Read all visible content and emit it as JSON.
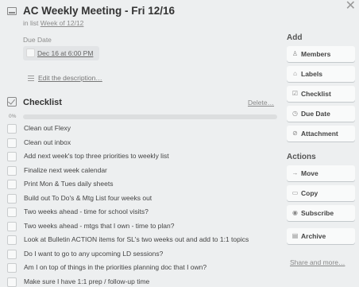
{
  "card": {
    "title": "AC Weekly Meeting - Fri 12/16",
    "in_list_prefix": "in list",
    "list_name": "Week of 12/12",
    "close_glyph": "✕",
    "due_date_label": "Due Date",
    "due_date_value": "Dec 16 at 6:00 PM",
    "description_link": "Edit the description…"
  },
  "checklist": {
    "title": "Checklist",
    "delete_label": "Delete…",
    "progress_label": "0%",
    "progress_value": 0,
    "progress_color": "#5aac44",
    "items": [
      "Clean out Flexy",
      "Clean out inbox",
      "Add next week's top three priorities to weekly list",
      "Finalize next week calendar",
      "Print Mon & Tues daily sheets",
      "Build out To Do's & Mtg List four weeks out",
      "Two weeks ahead - time for school visits?",
      "Two weeks ahead - mtgs that I own - time to plan?",
      "Look at Bulletin ACTION items for SL's two weeks out and add to 1:1 topics",
      "Do I want to go to any upcoming LD sessions?",
      "Am I on top of things in the priorities planning doc that I own?",
      "Make sure I have 1:1 prep / follow-up time"
    ]
  },
  "sidebar": {
    "add_heading": "Add",
    "add_buttons": [
      {
        "label": "Members",
        "icon": "person-icon",
        "glyph": "♙"
      },
      {
        "label": "Labels",
        "icon": "tag-icon",
        "glyph": "⌂"
      },
      {
        "label": "Checklist",
        "icon": "checkbox-icon",
        "glyph": "☑"
      },
      {
        "label": "Due Date",
        "icon": "clock-icon",
        "glyph": "◷"
      },
      {
        "label": "Attachment",
        "icon": "paperclip-icon",
        "glyph": "⊘"
      }
    ],
    "actions_heading": "Actions",
    "action_buttons": [
      {
        "label": "Move",
        "icon": "arrow-right-icon",
        "glyph": "→"
      },
      {
        "label": "Copy",
        "icon": "card-icon",
        "glyph": "▭"
      },
      {
        "label": "Subscribe",
        "icon": "eye-icon",
        "glyph": "◉"
      },
      {
        "label": "Archive",
        "icon": "archive-icon",
        "glyph": "▤"
      }
    ],
    "share_link": "Share and more…"
  }
}
